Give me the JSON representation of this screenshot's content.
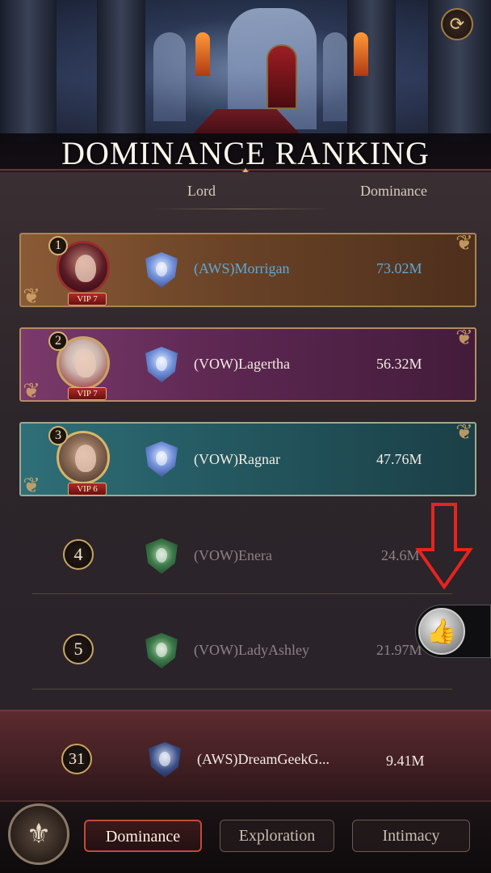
{
  "header": {
    "title": "DOMINANCE RANKING",
    "refresh_icon": "refresh-icon"
  },
  "columns": {
    "lord": "Lord",
    "dominance": "Dominance"
  },
  "top_ranks": [
    {
      "rank": "1",
      "vip": "VIP 7",
      "name": "(AWS)Morrigan",
      "dominance": "73.02M",
      "name_color": "#5fa9d6",
      "score_color": "#5fa9d6"
    },
    {
      "rank": "2",
      "vip": "VIP 7",
      "name": "(VOW)Lagertha",
      "dominance": "56.32M",
      "name_color": "#f3ece2",
      "score_color": "#f3ece2"
    },
    {
      "rank": "3",
      "vip": "VIP 6",
      "name": "(VOW)Ragnar",
      "dominance": "47.76M",
      "name_color": "#f3ece2",
      "score_color": "#f3ece2"
    }
  ],
  "other_ranks": [
    {
      "rank": "4",
      "name": "(VOW)Enera",
      "dominance": "24.6M"
    },
    {
      "rank": "5",
      "name": "(VOW)LadyAshley",
      "dominance": "21.97M"
    }
  ],
  "my_rank": {
    "rank": "31",
    "name": "(AWS)DreamGeekG...",
    "dominance": "9.41M"
  },
  "like_icon": "thumbs-up-icon",
  "nav": {
    "tabs": [
      "Dominance",
      "Exploration",
      "Intimacy"
    ],
    "active": "Dominance"
  }
}
